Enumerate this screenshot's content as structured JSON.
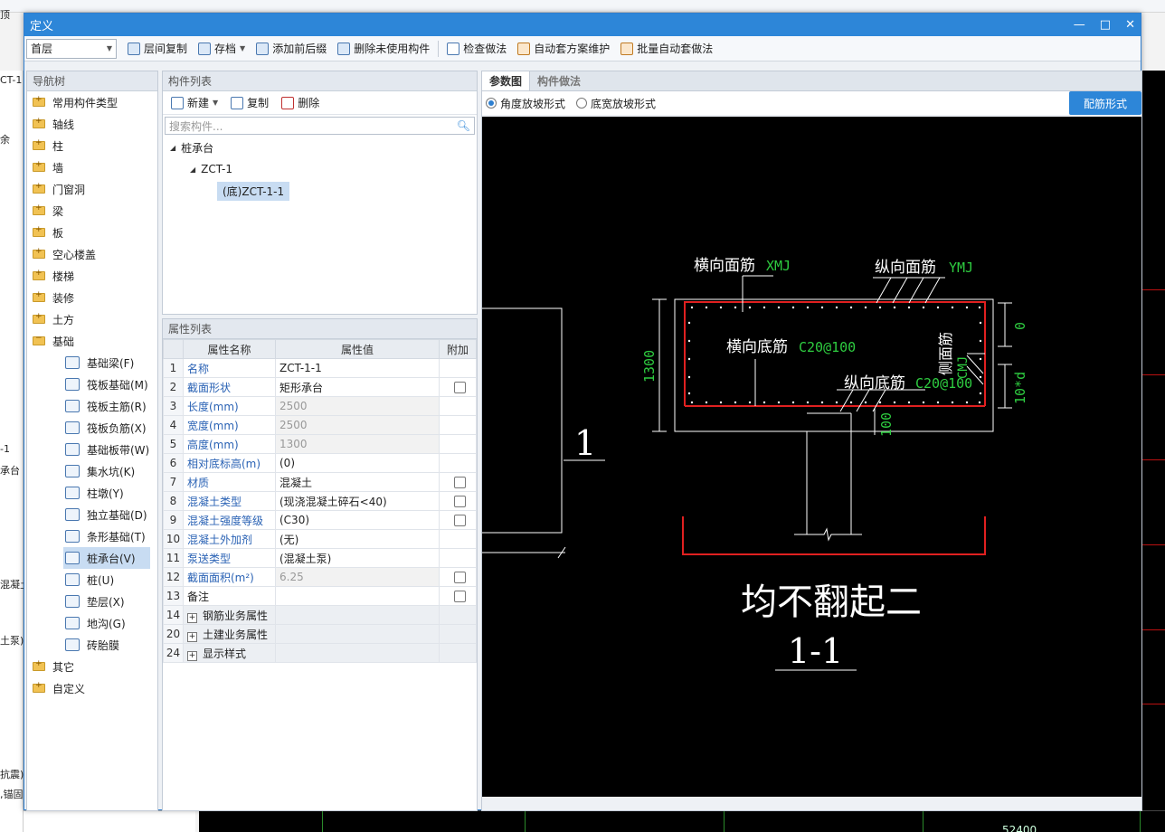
{
  "background_app": {
    "left_fragments": [
      "顶",
      "CT-1",
      "余",
      "-1",
      "承台",
      "混凝土",
      "土泵)",
      "抗震)",
      ",锚固"
    ],
    "canvas_label": "52400"
  },
  "dialog": {
    "title": "定义",
    "win_minimize": "—",
    "win_maximize": "□",
    "win_close": "✕"
  },
  "toolbar": {
    "floor": "首层",
    "items": [
      "层间复制",
      "存档",
      "添加前后缀",
      "删除未使用构件",
      "检查做法",
      "自动套方案维护",
      "批量自动套做法"
    ]
  },
  "nav": {
    "title": "导航树",
    "items": [
      "常用构件类型",
      "轴线",
      "柱",
      "墙",
      "门窗洞",
      "梁",
      "板",
      "空心楼盖",
      "楼梯",
      "装修",
      "土方",
      "基础"
    ],
    "sub_items": [
      "基础梁(F)",
      "筏板基础(M)",
      "筏板主筋(R)",
      "筏板负筋(X)",
      "基础板带(W)",
      "集水坑(K)",
      "柱墩(Y)",
      "独立基础(D)",
      "条形基础(T)",
      "桩承台(V)",
      "桩(U)",
      "垫层(X)",
      "地沟(G)",
      "砖胎膜"
    ],
    "selected_sub": "桩承台(V)",
    "after_items": [
      "其它",
      "自定义"
    ]
  },
  "complist": {
    "title": "构件列表",
    "new_label": "新建",
    "copy_label": "复制",
    "delete_label": "删除",
    "search_placeholder": "搜索构件...",
    "tree": {
      "root": "桩承台",
      "child": "ZCT-1",
      "leaf": "(底)ZCT-1-1"
    }
  },
  "props": {
    "title": "属性列表",
    "headers": [
      "属性名称",
      "属性值",
      "附加"
    ],
    "rows": [
      {
        "idx": "1",
        "name": "名称",
        "value": "ZCT-1-1",
        "link": true,
        "gray": false,
        "cb": false
      },
      {
        "idx": "2",
        "name": "截面形状",
        "value": "矩形承台",
        "link": true,
        "gray": false,
        "cb": true
      },
      {
        "idx": "3",
        "name": "长度(mm)",
        "value": "2500",
        "link": true,
        "gray": true,
        "cb": false
      },
      {
        "idx": "4",
        "name": "宽度(mm)",
        "value": "2500",
        "link": true,
        "gray": true,
        "cb": false
      },
      {
        "idx": "5",
        "name": "高度(mm)",
        "value": "1300",
        "link": true,
        "gray": true,
        "cb": false
      },
      {
        "idx": "6",
        "name": "相对底标高(m)",
        "value": "(0)",
        "link": true,
        "gray": false,
        "cb": false
      },
      {
        "idx": "7",
        "name": "材质",
        "value": "混凝土",
        "link": true,
        "gray": false,
        "cb": true
      },
      {
        "idx": "8",
        "name": "混凝土类型",
        "value": "(现浇混凝土碎石<40)",
        "link": true,
        "gray": false,
        "cb": true
      },
      {
        "idx": "9",
        "name": "混凝土强度等级",
        "value": "(C30)",
        "link": true,
        "gray": false,
        "cb": true
      },
      {
        "idx": "10",
        "name": "混凝土外加剂",
        "value": "(无)",
        "link": true,
        "gray": false,
        "cb": false
      },
      {
        "idx": "11",
        "name": "泵送类型",
        "value": "(混凝土泵)",
        "link": true,
        "gray": false,
        "cb": false
      },
      {
        "idx": "12",
        "name": "截面面积(m²)",
        "value": "6.25",
        "link": true,
        "gray": true,
        "cb": true
      },
      {
        "idx": "13",
        "name": "备注",
        "value": "",
        "link": false,
        "gray": false,
        "cb": true
      }
    ],
    "groups": [
      {
        "idx": "14",
        "name": "钢筋业务属性"
      },
      {
        "idx": "20",
        "name": "土建业务属性"
      },
      {
        "idx": "24",
        "name": "显示样式"
      }
    ]
  },
  "param": {
    "tab_active": "参数图",
    "tab_other": "构件做法",
    "radio1": "角度放坡形式",
    "radio2": "底宽放坡形式",
    "rebar_button": "配筋形式",
    "drawing": {
      "xmj_label": "横向面筋",
      "xmj_code": "XMJ",
      "ymj_label": "纵向面筋",
      "ymj_code": "YMJ",
      "xdj_label": "横向底筋",
      "xdj_code": "C20@100",
      "ydj_label": "纵向底筋",
      "ydj_code": "C20@100",
      "side_label": "侧面筋",
      "side_code": "CMJ",
      "dim_height": "1300",
      "dim_top": "0",
      "dim_right": "10*d",
      "dim_bottom": "100",
      "section_mark": "1",
      "caption": "均不翻起二",
      "section_title": "1-1"
    }
  }
}
